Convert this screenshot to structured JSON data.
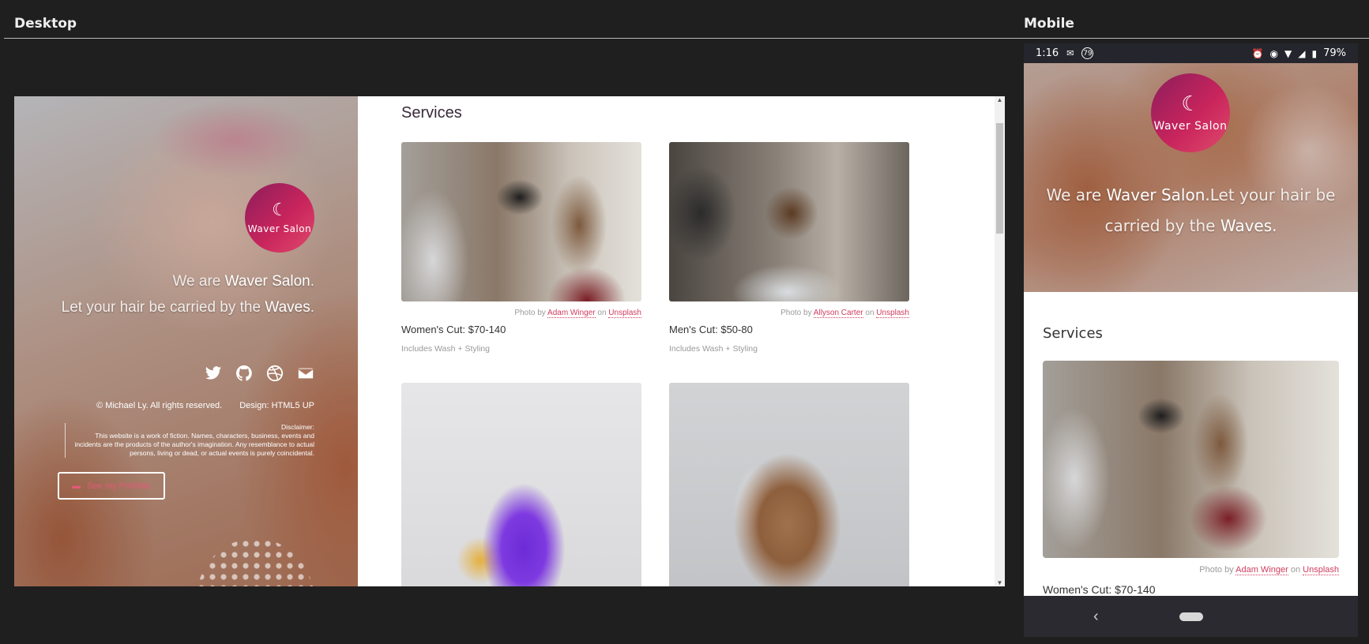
{
  "labels": {
    "desktop": "Desktop",
    "mobile": "Mobile"
  },
  "brand": {
    "name": "Waver Salon",
    "accent": "#c8245c"
  },
  "hero": {
    "tagline_prefix": "We are ",
    "tagline_brand": "Waver Salon",
    "tagline_dot": ".",
    "tagline2_prefix": "Let your hair be carried by the ",
    "tagline2_brand": "Waves",
    "tagline2_dot": ".",
    "socials": [
      "twitter-icon",
      "github-icon",
      "dribbble-icon",
      "envelope-icon"
    ],
    "copyright": "© Michael Ly. All rights reserved.",
    "design_credit": "Design: HTML5 UP",
    "disclaimer_title": "Disclaimer:",
    "disclaimer_text": "This website is a work of fiction. Names, characters, business, events and incidents are the products of the author's imagination. Any resemblance to actual persons, living or dead, or actual events is purely coincidental.",
    "portfolio_button": "See my Portfolio"
  },
  "services": {
    "title": "Services",
    "photo_by": "Photo by ",
    "on": " on ",
    "cards": [
      {
        "photographer": "Adam Winger",
        "source": "Unsplash",
        "title": "Women's Cut: $70-140",
        "desc": "Includes Wash + Styling"
      },
      {
        "photographer": "Allyson Carter",
        "source": "Unsplash",
        "title": "Men's Cut: $50-80",
        "desc": "Includes Wash + Styling"
      }
    ]
  },
  "mobile": {
    "status": {
      "time": "1:16",
      "battery": "79%",
      "badge": "79"
    },
    "tagline_prefix": "We are ",
    "tagline_brand": "Waver Salon.",
    "tagline_mid": "Let your hair be carried by the ",
    "tagline_brand2": "Waves.",
    "services_title": "Services",
    "card_title": "Women's Cut: $70-140",
    "photographer": "Adam Winger",
    "source": "Unsplash",
    "photo_by": "Photo by ",
    "on": " on "
  }
}
